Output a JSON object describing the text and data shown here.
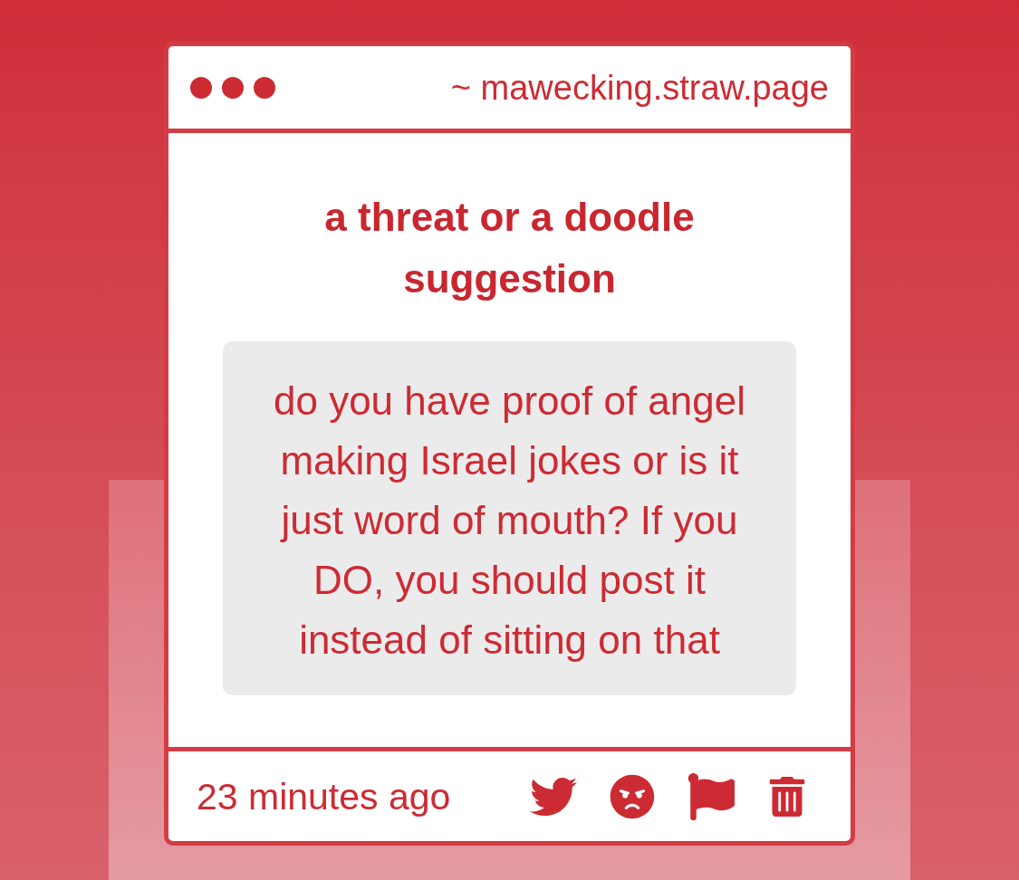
{
  "window": {
    "address": "~ mawecking.straw.page"
  },
  "post": {
    "title": "a threat or a doodle suggestion",
    "message": "do you have proof of angel making Israel jokes or is it just word of mouth? If you DO, you should post it instead of sitting on that"
  },
  "footer": {
    "time": "23 minutes ago"
  }
}
